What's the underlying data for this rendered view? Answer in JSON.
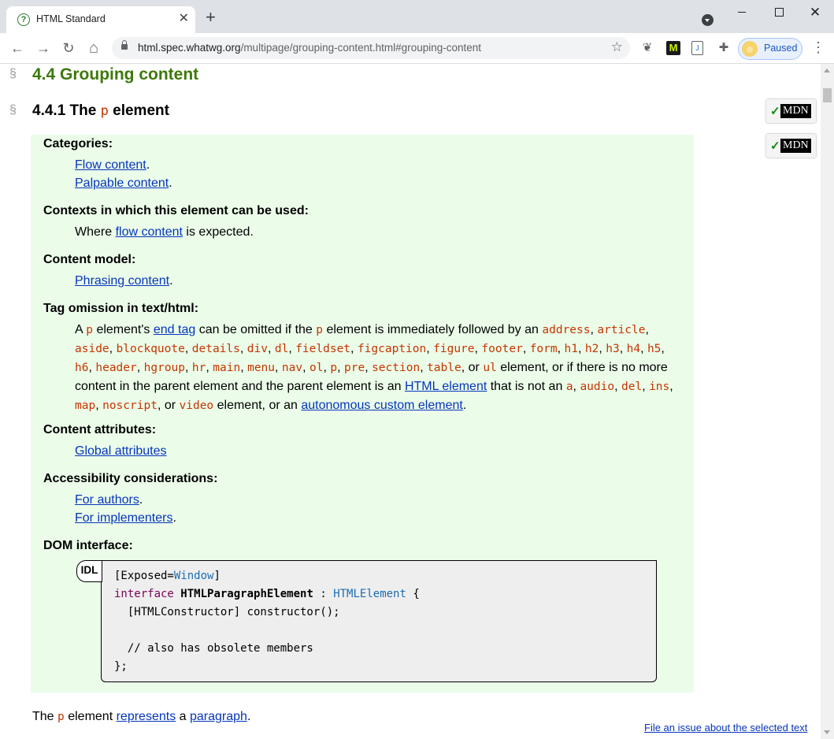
{
  "browser": {
    "tab_title": "HTML Standard",
    "tab_favicon_glyph": "?",
    "tab_close": "✕",
    "new_tab": "+",
    "win_close": "✕",
    "back": "←",
    "forward": "→",
    "reload": "↻",
    "home": "⌂",
    "url_host": "html.spec.whatwg.org",
    "url_path": "/multipage/grouping-content.html#grouping-content",
    "bookmark_star": "☆",
    "ext_bird": "❦",
    "ext_m": "M",
    "ext_doc": "J",
    "ext_puzzle": "✚",
    "profile_label": "Paused",
    "menu": "⋮"
  },
  "page": {
    "section_marker": "§",
    "section_title": "4.4 Grouping content",
    "sub_title_prefix": "4.4.1 The",
    "sub_title_code": "p",
    "sub_title_suffix": "element",
    "mdn_check": "✓",
    "mdn_label": "MDN",
    "categories_label": "Categories:",
    "categories": [
      "Flow content",
      "Palpable content"
    ],
    "contexts_label": "Contexts in which this element can be used:",
    "contexts_pre": "Where",
    "contexts_link": "flow content",
    "contexts_post": "is expected.",
    "content_model_label": "Content model:",
    "content_model_link": "Phrasing content",
    "tag_omission_label": "Tag omission in text/html:",
    "tag_omission_a": "A",
    "tag_omission_p1": "p",
    "tag_omission_b": "element's",
    "tag_omission_end_tag": "end tag",
    "tag_omission_c": "can be omitted if the",
    "tag_omission_p2": "p",
    "tag_omission_d": "element is immediately followed by an",
    "tag_omission_elements": [
      "address",
      "article",
      "aside",
      "blockquote",
      "details",
      "div",
      "dl",
      "fieldset",
      "figcaption",
      "figure",
      "footer",
      "form",
      "h1",
      "h2",
      "h3",
      "h4",
      "h5",
      "h6",
      "header",
      "hgroup",
      "hr",
      "main",
      "menu",
      "nav",
      "ol",
      "p",
      "pre",
      "section",
      "table"
    ],
    "tag_omission_or": "or",
    "tag_omission_ul": "ul",
    "tag_omission_e": "element, or if there is no more content in the parent element and the parent element is an",
    "tag_omission_html_element": "HTML element",
    "tag_omission_f": "that is not an",
    "tag_omission_not_elements": [
      "a",
      "audio",
      "del",
      "ins",
      "map",
      "noscript"
    ],
    "tag_omission_video": "video",
    "tag_omission_g": "element, or an",
    "tag_omission_autonomous": "autonomous custom element",
    "content_attributes_label": "Content attributes:",
    "content_attributes_link": "Global attributes",
    "accessibility_label": "Accessibility considerations:",
    "accessibility_links": [
      "For authors",
      "For implementers"
    ],
    "dom_interface_label": "DOM interface:",
    "idl_tag": "IDL",
    "idl_line1_a": "[Exposed=",
    "idl_line1_window": "Window",
    "idl_line1_b": "]",
    "idl_line2_interface": "interface",
    "idl_line2_name": "HTMLParagraphElement",
    "idl_line2_colon": ":",
    "idl_line2_parent": "HTMLElement",
    "idl_line2_brace": "{",
    "idl_line3": "  [HTMLConstructor] constructor();",
    "idl_line5": "  // also has obsolete members",
    "idl_line6": "};",
    "para_pre": "The",
    "para_code": "p",
    "para_mid": "element",
    "para_represents": "represents",
    "para_a": "a",
    "para_paragraph": "paragraph",
    "para_end": ".",
    "file_issue": "File an issue about the selected text"
  }
}
